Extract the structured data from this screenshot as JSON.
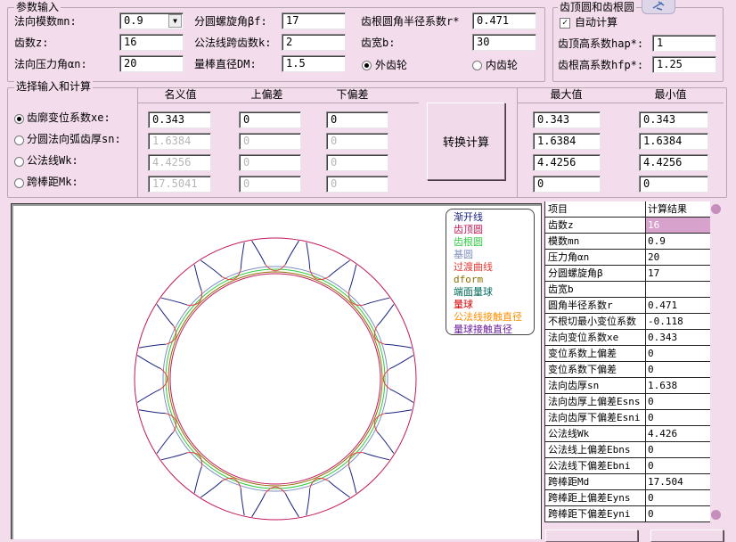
{
  "params": {
    "title": "参数输入",
    "normal_module_label": "法向模数mn:",
    "normal_module_value": "0.9",
    "teeth_label": "齿数z:",
    "teeth_value": "16",
    "pressure_angle_label": "法向压力角αn:",
    "pressure_angle_value": "20",
    "helix_angle_label": "分圆螺旋角βf:",
    "helix_angle_value": "17",
    "span_teeth_label": "公法线跨齿数k:",
    "span_teeth_value": "2",
    "pin_diameter_label": "量棒直径DM:",
    "pin_diameter_value": "1.5",
    "root_fillet_label": "齿根圆角半径系数r*",
    "root_fillet_value": "0.471",
    "face_width_label": "齿宽b:",
    "face_width_value": "30",
    "external_gear_label": "外齿轮",
    "internal_gear_label": "内齿轮"
  },
  "tip_root": {
    "title": "齿顶圆和齿根圆",
    "auto_calc_label": "自动计算",
    "addendum_label": "齿顶高系数hap*:",
    "addendum_value": "1",
    "dedendum_label": "齿根高系数hfp*:",
    "dedendum_value": "1.25"
  },
  "select": {
    "title": "选择输入和计算",
    "col_nominal": "名义值",
    "col_upper": "上偏差",
    "col_lower": "下偏差",
    "col_max": "最大值",
    "col_min": "最小值",
    "convert_button": "转换计算",
    "rows": [
      {
        "label": "齿廓变位系数xe:",
        "nominal": "0.343",
        "upper": "0",
        "lower": "0",
        "max": "0.343",
        "min": "0.343"
      },
      {
        "label": "分圆法向弧齿厚sn:",
        "nominal": "1.6384",
        "upper": "0",
        "lower": "0",
        "max": "1.6384",
        "min": "1.6384"
      },
      {
        "label": "公法线Wk:",
        "nominal": "4.4256",
        "upper": "0",
        "lower": "0",
        "max": "4.4256",
        "min": "4.4256"
      },
      {
        "label": "跨棒距Mk:",
        "nominal": "17.5041",
        "upper": "0",
        "lower": "0",
        "max": "0",
        "min": "0"
      }
    ]
  },
  "legend": {
    "items": [
      {
        "label": "渐开线",
        "color": "#1a237e"
      },
      {
        "label": "齿顶圆",
        "color": "#c2185b"
      },
      {
        "label": "齿根圆",
        "color": "#2ecc40"
      },
      {
        "label": "基圆",
        "color": "#7f8fbf"
      },
      {
        "label": "过渡曲线",
        "color": "#e53935"
      },
      {
        "label": "dform",
        "color": "#8d6e00"
      },
      {
        "label": "端面量球",
        "color": "#00695c"
      },
      {
        "label": "量球",
        "color": "#d50000"
      },
      {
        "label": "公法线接触直径",
        "color": "#ff8f00"
      },
      {
        "label": "量球接触直径",
        "color": "#6a1b9a"
      }
    ]
  },
  "results": {
    "header_item": "项目",
    "header_result": "计算结果",
    "rows": [
      {
        "item": "齿数z",
        "value": "16"
      },
      {
        "item": "模数mn",
        "value": "0.9"
      },
      {
        "item": "压力角αn",
        "value": "20"
      },
      {
        "item": "分圆螺旋角β",
        "value": "17"
      },
      {
        "item": "齿宽b",
        "value": ""
      },
      {
        "item": "圆角半径系数r",
        "value": "0.471"
      },
      {
        "item": "不根切最小变位系数",
        "value": "-0.118"
      },
      {
        "item": "法向变位系数xe",
        "value": "0.343"
      },
      {
        "item": "变位系数上偏差",
        "value": "0"
      },
      {
        "item": "变位系数下偏差",
        "value": "0"
      },
      {
        "item": "法向齿厚sn",
        "value": "1.638"
      },
      {
        "item": "法向齿厚上偏差Esns",
        "value": "0"
      },
      {
        "item": "法向齿厚下偏差Esni",
        "value": "0"
      },
      {
        "item": "公法线Wk",
        "value": "4.426"
      },
      {
        "item": "公法线上偏差Ebns",
        "value": "0"
      },
      {
        "item": "公法线下偏差Ebni",
        "value": "0"
      },
      {
        "item": "跨棒距Md",
        "value": "17.504"
      },
      {
        "item": "跨棒距上偏差Eyns",
        "value": "0"
      },
      {
        "item": "跨棒距下偏差Eyni",
        "value": "0"
      }
    ]
  },
  "gear": {
    "teeth": 16,
    "colors": {
      "addendum": "#c2185b",
      "involute": "#1a237e",
      "fillet": "#e53935",
      "root": "#2ecc40",
      "base": "#7f8fbf",
      "inner": "#8d6e00"
    }
  }
}
